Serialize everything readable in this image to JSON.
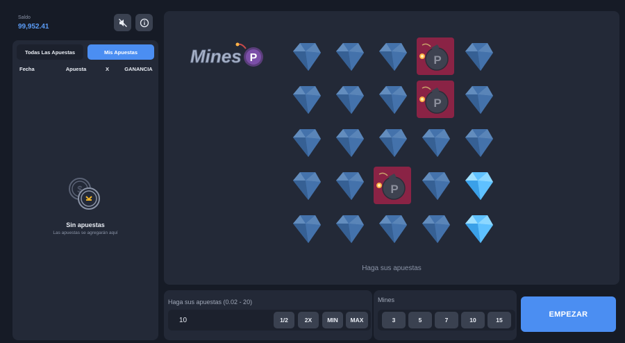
{
  "balance": {
    "label": "Saldo",
    "value": "99,952.41"
  },
  "header_icons": [
    "mute-icon",
    "info-icon"
  ],
  "history": {
    "tabs": [
      {
        "label": "Todas Las Apuestas",
        "active": false
      },
      {
        "label": "Mis Apuestas",
        "active": true
      }
    ],
    "columns": [
      "Fecha",
      "Apuesta",
      "X",
      "GANANCIA"
    ],
    "empty_title": "Sin apuestas",
    "empty_subtitle": "Las apuestas se agregarán aquí"
  },
  "game": {
    "logo_text": "Mines",
    "logo_badge": "P",
    "grid": [
      [
        "gem-dim",
        "gem-dim",
        "gem-dim",
        "bomb",
        "gem-dim"
      ],
      [
        "gem-dim",
        "gem-dim",
        "gem-dim",
        "bomb",
        "gem-dim"
      ],
      [
        "gem-dim",
        "gem-dim",
        "gem-dim",
        "gem-dim",
        "gem-dim"
      ],
      [
        "gem-dim",
        "gem-dim",
        "bomb",
        "gem-dim",
        "gem-bright"
      ],
      [
        "gem-dim",
        "gem-dim",
        "gem-dim",
        "gem-dim",
        "gem-bright"
      ]
    ],
    "hint": "Haga sus apuestas"
  },
  "bet": {
    "label": "Haga sus apuestas (0.02 - 20)",
    "value": "10",
    "buttons": [
      "1/2",
      "2X",
      "MIN",
      "MAX"
    ]
  },
  "mines": {
    "label": "Mines",
    "options": [
      "3",
      "5",
      "7",
      "10",
      "15"
    ]
  },
  "start_label": "EMPEZAR",
  "colors": {
    "accent": "#4b8ef2",
    "bomb_tile": "#8a2345",
    "gem_bright": "#5fc1ff",
    "gem_dim": "#4a7fc0"
  }
}
